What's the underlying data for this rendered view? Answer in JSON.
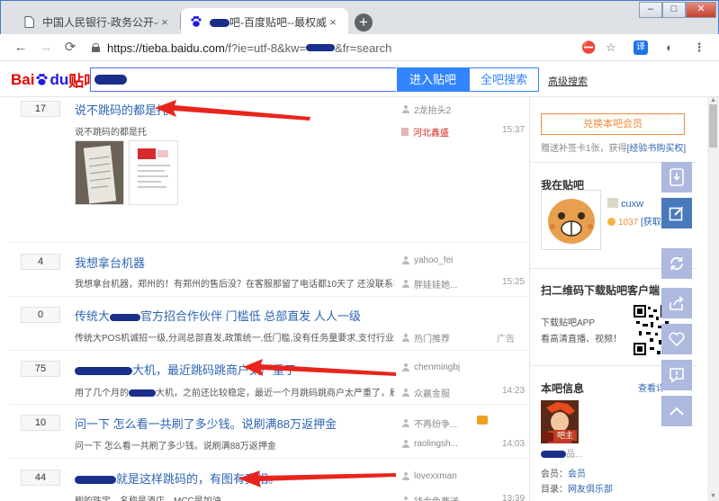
{
  "browser": {
    "tabs": [
      {
        "title": "中国人民银行-政务公开-行政执法",
        "close": "×"
      },
      {
        "title": "吧-百度贴吧--最权威、最",
        "close": "×"
      }
    ],
    "new_tab": "+",
    "window_controls": {
      "minimize": "–",
      "maximize": "□",
      "close": "✕"
    },
    "url_host": "https://tieba.baidu.com",
    "url_path": "/f?ie=utf-8&kw=",
    "url_tail": "&fr=search"
  },
  "header": {
    "logo_text_red": "Bai",
    "logo_text_blue": "du",
    "logo_suffix": "贴吧",
    "enter_button": "进入贴吧",
    "search_all_button": "全吧搜索",
    "advanced_search": "高级搜索"
  },
  "threads": [
    {
      "reply_count": "17",
      "title": "说不跳码的都是托",
      "author": "2龙抬头2",
      "abstract": "说不跳码的都是托",
      "last_reply": "河北鑫盛",
      "time": "15:37"
    },
    {
      "reply_count": "4",
      "title": "我想拿台机器",
      "author": "yahoo_fei",
      "abstract": "我想拿台机器，郑州的！有郑州的售后没？在客服那留了电话都10天了 还没联系我...",
      "last_reply": "胖娃娃她...",
      "time": "15:25"
    },
    {
      "reply_count": "0",
      "title_pre": "传统大",
      "title_post": "官方招合作伙伴 门槛低 总部直发 人人一级",
      "author": "",
      "abstract": "传统大POS机诚招一级,分润总部直发,政策统一,低门槛,没有任务量要求,支付行业2.0,...",
      "last_reply": "热门推荐",
      "time": "广告"
    },
    {
      "reply_count": "75",
      "title_pre": "",
      "title_post": "大机，最近跳码跳商户太严重了",
      "author": "chenmingbj",
      "abstract_pre": "用了几个月的",
      "abstract_post": "大机，之前还比较稳定，最近一个月跳码跳商户太严重了，刷的...",
      "last_reply": "众赢金服",
      "time": "14:23"
    },
    {
      "reply_count": "10",
      "title": "问一下 怎么看一共刷了多少钱。说刷满88万返押金",
      "author": "不再纷争...",
      "abstract": "问一下 怎么看一共刷了多少钱。说刷满88万返押金",
      "last_reply": "raolingsh...",
      "time": "14:03"
    },
    {
      "reply_count": "44",
      "title_post": "就是这样跳码的，有图有真相。",
      "author": "lovexxman",
      "abstract": "刷的珠宝，名称是酒店，MCC是加油。",
      "last_reply": "钱金色赛送",
      "time": "13:39"
    }
  ],
  "aside": {
    "vip_button": "兑换本吧会员",
    "vip_note": "赠送补签卡1张，获得",
    "vip_note_link": "[经验书购买权]",
    "my_section_title": "我在贴吧",
    "username": "cuxw",
    "coins": "1037",
    "coins_link": "[获取",
    "app_section_title": "扫二维码下载贴吧客户端",
    "app_line1": "下载贴吧APP",
    "app_line2": "看高清直播、视频！",
    "info_section_title": "本吧信息",
    "info_more": "查看详",
    "owner_badge": "吧主",
    "member_label": "会员：",
    "member_value": "会员",
    "dir_label": "目录：",
    "dir_value": "网友俱乐部"
  },
  "colors": {
    "accent_blue": "#3385ff",
    "link_blue": "#2d64b3",
    "annotation_red": "#e8251c",
    "float_bar": "#aeb9df"
  }
}
